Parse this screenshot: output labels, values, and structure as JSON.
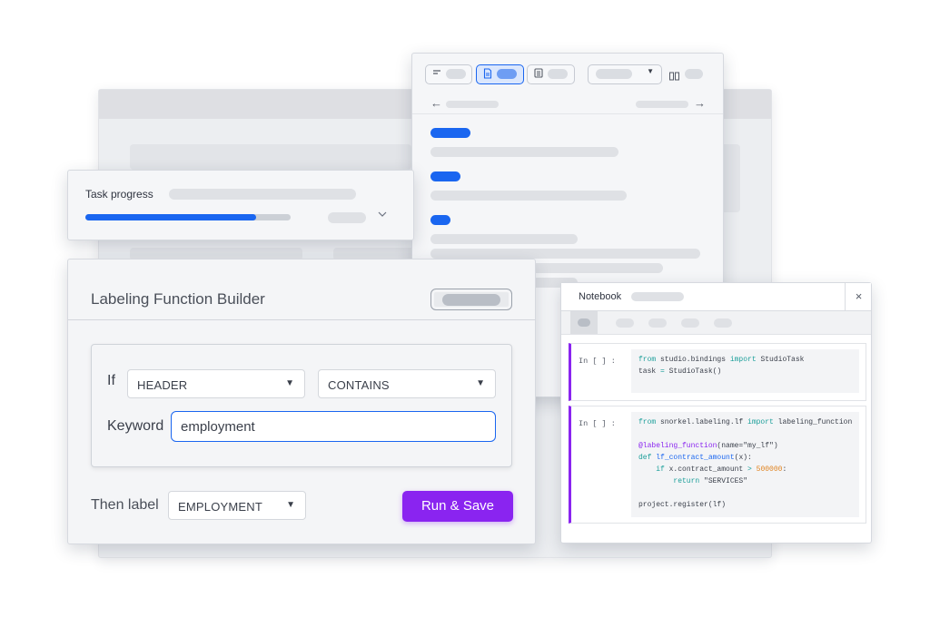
{
  "task_progress": {
    "title": "Task progress",
    "progress_percent": 83
  },
  "doc_viewer": {
    "toolbar_icons": [
      "lines-icon",
      "document-icon",
      "table-icon",
      "chevron-down-icon",
      "columns-icon"
    ],
    "nav_icons": [
      "arrow-left-icon",
      "arrow-right-icon"
    ]
  },
  "builder": {
    "title": "Labeling Function Builder",
    "if_label": "If",
    "field_select": "HEADER",
    "operator_select": "CONTAINS",
    "keyword_label": "Keyword",
    "keyword_value": "employment",
    "then_label": "Then label",
    "label_select": "EMPLOYMENT",
    "run_save_label": "Run & Save",
    "accent_color": "#8a24f0",
    "focus_color": "#1a66f0"
  },
  "notebook": {
    "title": "Notebook",
    "close_glyph": "×",
    "cells": [
      {
        "prompt": "In [  ] :",
        "lines": [
          {
            "parts": [
              [
                "kw",
                "from"
              ],
              [
                "plain",
                " studio.bindings "
              ],
              [
                "kw",
                "import"
              ],
              [
                "plain",
                " StudioTask"
              ]
            ]
          },
          {
            "parts": [
              [
                "plain",
                "task "
              ],
              [
                "kw",
                "="
              ],
              [
                "plain",
                " StudioTask()"
              ]
            ]
          }
        ]
      },
      {
        "prompt": "In [  ] :",
        "lines": [
          {
            "parts": [
              [
                "kw",
                "from"
              ],
              [
                "plain",
                " snorkel.labeling.lf "
              ],
              [
                "kw",
                "import"
              ],
              [
                "plain",
                " labeling_function"
              ]
            ]
          },
          {
            "parts": [
              [
                "plain",
                ""
              ]
            ]
          },
          {
            "parts": [
              [
                "dec",
                "@labeling_function"
              ],
              [
                "plain",
                "(name=\"my_lf\")"
              ]
            ]
          },
          {
            "parts": [
              [
                "kw",
                "def"
              ],
              [
                "plain",
                " "
              ],
              [
                "fn",
                "lf_contract_amount"
              ],
              [
                "plain",
                "(x):"
              ]
            ]
          },
          {
            "parts": [
              [
                "plain",
                "    "
              ],
              [
                "kw",
                "if"
              ],
              [
                "plain",
                " x.contract_amount "
              ],
              [
                "kw",
                ">"
              ],
              [
                "plain",
                " "
              ],
              [
                "num",
                "500000"
              ],
              [
                "plain",
                ":"
              ]
            ]
          },
          {
            "parts": [
              [
                "plain",
                "    "
              ],
              [
                "kw",
                "    return"
              ],
              [
                "plain",
                " \"SERVICES\""
              ]
            ]
          },
          {
            "parts": [
              [
                "plain",
                ""
              ]
            ]
          },
          {
            "parts": [
              [
                "plain",
                "project.register(lf)"
              ]
            ]
          }
        ]
      }
    ]
  }
}
